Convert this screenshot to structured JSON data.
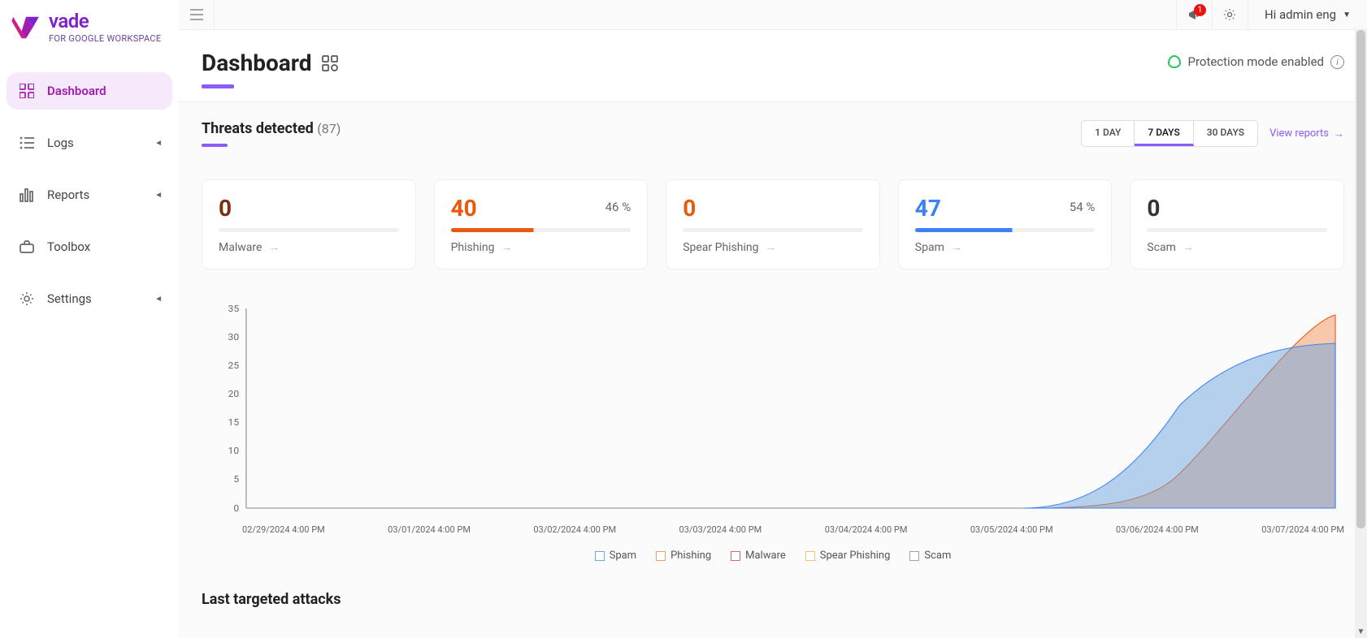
{
  "logo": {
    "brand": "vade",
    "subtitle": "FOR GOOGLE WORKSPACE"
  },
  "nav": [
    {
      "label": "Dashboard",
      "active": true,
      "expandable": false
    },
    {
      "label": "Logs",
      "active": false,
      "expandable": true
    },
    {
      "label": "Reports",
      "active": false,
      "expandable": true
    },
    {
      "label": "Toolbox",
      "active": false,
      "expandable": false
    },
    {
      "label": "Settings",
      "active": false,
      "expandable": true
    }
  ],
  "topbar": {
    "notification_count": "1",
    "user_greeting": "Hi admin eng"
  },
  "page": {
    "title": "Dashboard",
    "protection_status": "Protection mode enabled"
  },
  "threats": {
    "title": "Threats detected",
    "total": "(87)",
    "ranges": [
      "1 DAY",
      "7 DAYS",
      "30 DAYS"
    ],
    "active_range": "7 DAYS",
    "view_reports": "View reports",
    "cards": {
      "malware": {
        "value": "0",
        "label": "Malware",
        "percent": ""
      },
      "phishing": {
        "value": "40",
        "label": "Phishing",
        "percent": "46 %"
      },
      "spear": {
        "value": "0",
        "label": "Spear Phishing",
        "percent": ""
      },
      "spam": {
        "value": "47",
        "label": "Spam",
        "percent": "54 %"
      },
      "scam": {
        "value": "0",
        "label": "Scam",
        "percent": ""
      }
    }
  },
  "chart_data": {
    "type": "area",
    "title": "",
    "xlabel": "",
    "ylabel": "",
    "ylim": [
      0,
      35
    ],
    "y_ticks": [
      0,
      5,
      10,
      15,
      20,
      25,
      30,
      35
    ],
    "categories": [
      "02/29/2024 4:00 PM",
      "03/01/2024 4:00 PM",
      "03/02/2024 4:00 PM",
      "03/03/2024 4:00 PM",
      "03/04/2024 4:00 PM",
      "03/05/2024 4:00 PM",
      "03/06/2024 4:00 PM",
      "03/07/2024 4:00 PM"
    ],
    "series": [
      {
        "name": "Spam",
        "color": "#6ea6de",
        "values": [
          0,
          0,
          0,
          0,
          0,
          0,
          18,
          29
        ]
      },
      {
        "name": "Phishing",
        "color": "#f59e6a",
        "values": [
          0,
          0,
          0,
          0,
          0,
          0,
          6,
          34
        ]
      },
      {
        "name": "Malware",
        "color": "#d46868",
        "values": [
          0,
          0,
          0,
          0,
          0,
          0,
          0,
          0
        ]
      },
      {
        "name": "Spear Phishing",
        "color": "#f2c467",
        "values": [
          0,
          0,
          0,
          0,
          0,
          0,
          0,
          0
        ]
      },
      {
        "name": "Scam",
        "color": "#9ca3af",
        "values": [
          0,
          0,
          0,
          0,
          0,
          0,
          0,
          0
        ]
      }
    ]
  },
  "last_section": {
    "title": "Last targeted attacks"
  }
}
